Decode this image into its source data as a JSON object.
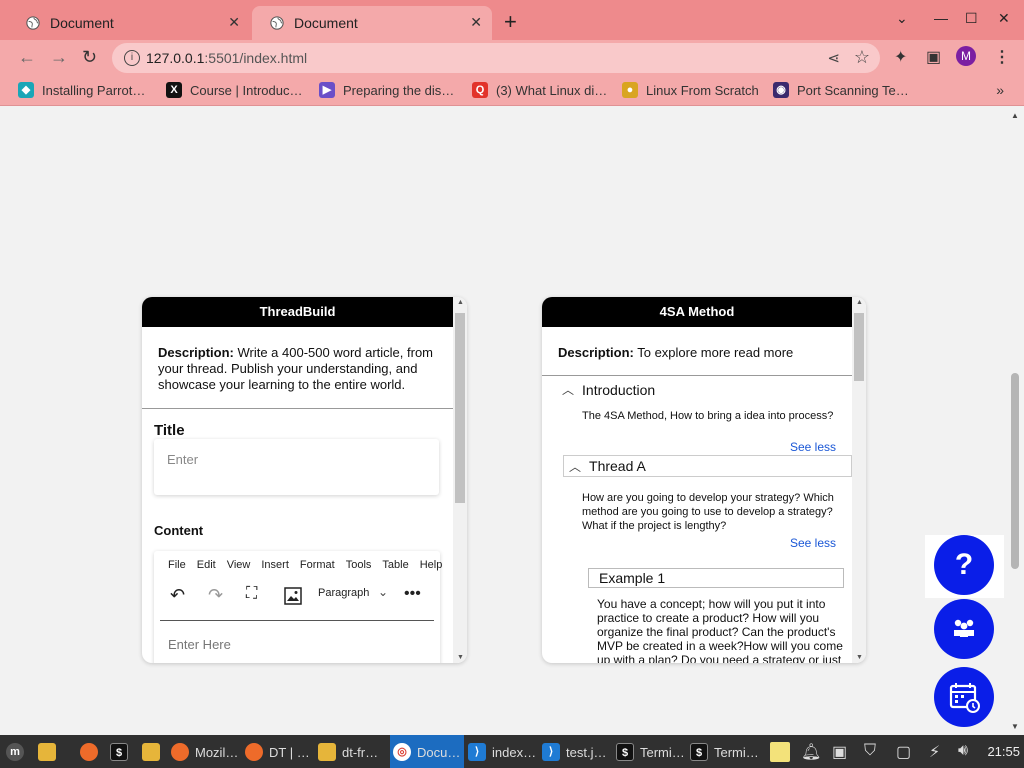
{
  "browser": {
    "tabs": [
      {
        "label": "Document",
        "active": false
      },
      {
        "label": "Document",
        "active": true
      }
    ],
    "url_host": "127.0.0.1",
    "url_rest": ":5501/index.html",
    "profile_initial": "M",
    "bookmarks": [
      "Installing Parrot…",
      "Course | Introduc…",
      "Preparing the dis…",
      "(3) What Linux di…",
      "Linux From Scratch",
      "Port Scanning Te…"
    ]
  },
  "card1": {
    "header": "ThreadBuild",
    "desc_label": "Description:",
    "desc_text": " Write a 400-500 word article, from your thread. Publish your understanding, and showcase your learning to the entire world.",
    "title_label": "Title",
    "title_placeholder": "Enter",
    "content_label": "Content",
    "editor_menu": [
      "File",
      "Edit",
      "View",
      "Insert",
      "Format",
      "Tools",
      "Table",
      "Help"
    ],
    "block_format": "Paragraph",
    "editor_placeholder": "Enter Here"
  },
  "card2": {
    "header": "4SA Method",
    "desc_label": "Description:",
    "desc_text": " To explore more read more",
    "intro_title": "Introduction",
    "intro_text": "The 4SA Method, How to bring a idea into process?",
    "see_less_1": "See less",
    "thread_title": "Thread A",
    "thread_text": "How are you going to develop your strategy? Which method are you going to use to develop a strategy? What if the project is lengthy?",
    "see_less_2": "See less",
    "example_title": "Example 1",
    "example_text": "You have a concept; how will you put it into practice to create a product? How will you organize the final product? Can the product's MVP be created in a week?How will you come up with a plan? Do you need a strategy or just"
  },
  "fabs": {
    "help_symbol": "?"
  },
  "taskbar": {
    "items": [
      "Mozil…",
      "DT | …",
      "dt-fr…",
      "Docu…",
      "index…",
      "test.j…",
      "Termi…",
      "Termi…"
    ],
    "clock": "21:55"
  },
  "colors": {
    "tab_bar": "#ee8a8c",
    "toolbar": "#f4a9aa",
    "fab_blue": "#0a1ee8",
    "link_blue": "#1a57d6"
  }
}
